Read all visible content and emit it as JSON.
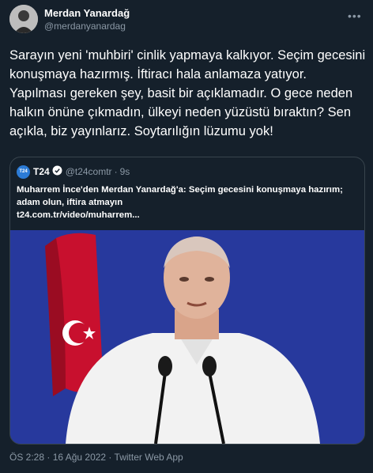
{
  "author": {
    "name": "Merdan Yanardağ",
    "handle": "@merdanyanardag"
  },
  "tweet": {
    "text": "Sarayın yeni 'muhbiri' cinlik yapmaya kalkıyor. Seçim gecesini konuşmaya hazırmış. İftiracı hala anlamaza yatıyor. Yapılması gereken şey, basit bir açıklamadır. O gece neden halkın önüne çıkmadın, ülkeyi neden yüzüstü bıraktın? Sen açıkla, biz yayınlarız. Soytarılığın lüzumu yok!"
  },
  "quote": {
    "logo_text": "T24",
    "name": "T24",
    "handle": "@t24comtr",
    "separator": "·",
    "time": "9s",
    "text_line1": "Muharrem İnce'den Merdan Yanardağ'a: Seçim gecesini konuşmaya hazırım;",
    "text_line2": "adam olun, iftira atmayın",
    "link": "t24.com.tr/video/muharrem...",
    "icon": "verified-badge-icon"
  },
  "footer": {
    "timestamp": "ÖS 2:28 · 16 Ağu 2022 · Twitter Web App"
  },
  "colors": {
    "background": "#15202b",
    "secondary_text": "#8b98a5",
    "border": "#38444d",
    "media_background": "#2c3fa8",
    "flag_red": "#c8102e"
  },
  "more_icon": "more-icon"
}
